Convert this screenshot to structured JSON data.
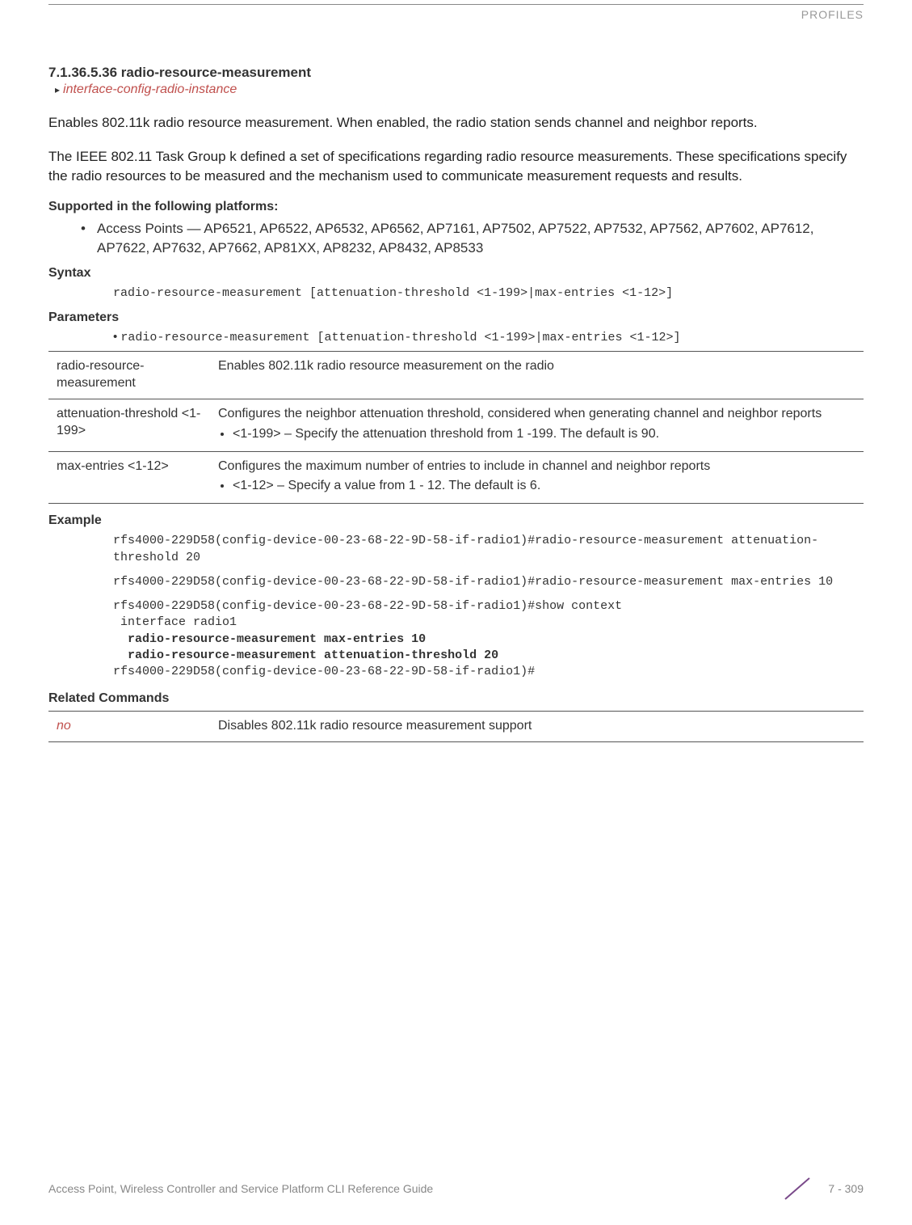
{
  "header": {
    "category": "PROFILES"
  },
  "section": {
    "number": "7.1.36.5.36 radio-resource-measurement",
    "breadcrumb": "interface-config-radio-instance"
  },
  "paragraphs": {
    "p1": "Enables 802.11k radio resource measurement. When enabled, the radio station sends channel and neighbor reports.",
    "p2": "The IEEE 802.11 Task Group k defined a set of specifications regarding radio resource measurements. These specifications specify the radio resources to be measured and the mechanism used to communicate measurement requests and results."
  },
  "supported": {
    "title": "Supported in the following platforms:",
    "item1": "Access Points — AP6521, AP6522, AP6532, AP6562, AP7161, AP7502, AP7522, AP7532, AP7562, AP7602, AP7612, AP7622, AP7632, AP7662, AP81XX, AP8232, AP8432, AP8533"
  },
  "syntax": {
    "title": "Syntax",
    "text": "radio-resource-measurement [attenuation-threshold <1-199>|max-entries <1-12>]"
  },
  "parameters": {
    "title": "Parameters",
    "cmdline": "radio-resource-measurement [attenuation-threshold <1-199>|max-entries <1-12>]",
    "rows": [
      {
        "name": "radio-resource-measurement",
        "desc": "Enables 802.11k radio resource measurement on the radio",
        "sub": ""
      },
      {
        "name": "attenuation-threshold <1-199>",
        "desc": "Configures the neighbor attenuation threshold, considered when generating channel and neighbor reports",
        "sub": "<1-199> – Specify the attenuation threshold from 1 -199. The default is 90."
      },
      {
        "name": "max-entries <1-12>",
        "desc": "Configures the maximum number of entries to include in channel and neighbor reports",
        "sub": "<1-12> – Specify a value from 1 - 12. The default is 6."
      }
    ]
  },
  "example": {
    "title": "Example",
    "block1": "rfs4000-229D58(config-device-00-23-68-22-9D-58-if-radio1)#radio-resource-measurement attenuation-threshold 20",
    "block2": "rfs4000-229D58(config-device-00-23-68-22-9D-58-if-radio1)#radio-resource-measurement max-entries 10",
    "block3a": "rfs4000-229D58(config-device-00-23-68-22-9D-58-if-radio1)#show context\n interface radio1",
    "block3b": "  radio-resource-measurement max-entries 10",
    "block3c": "  radio-resource-measurement attenuation-threshold 20",
    "block3d": "rfs4000-229D58(config-device-00-23-68-22-9D-58-if-radio1)#"
  },
  "related": {
    "title": "Related Commands",
    "rows": [
      {
        "name": "no",
        "desc": "Disables 802.11k radio resource measurement support"
      }
    ]
  },
  "footer": {
    "left": "Access Point, Wireless Controller and Service Platform CLI Reference Guide",
    "right": "7 - 309"
  }
}
